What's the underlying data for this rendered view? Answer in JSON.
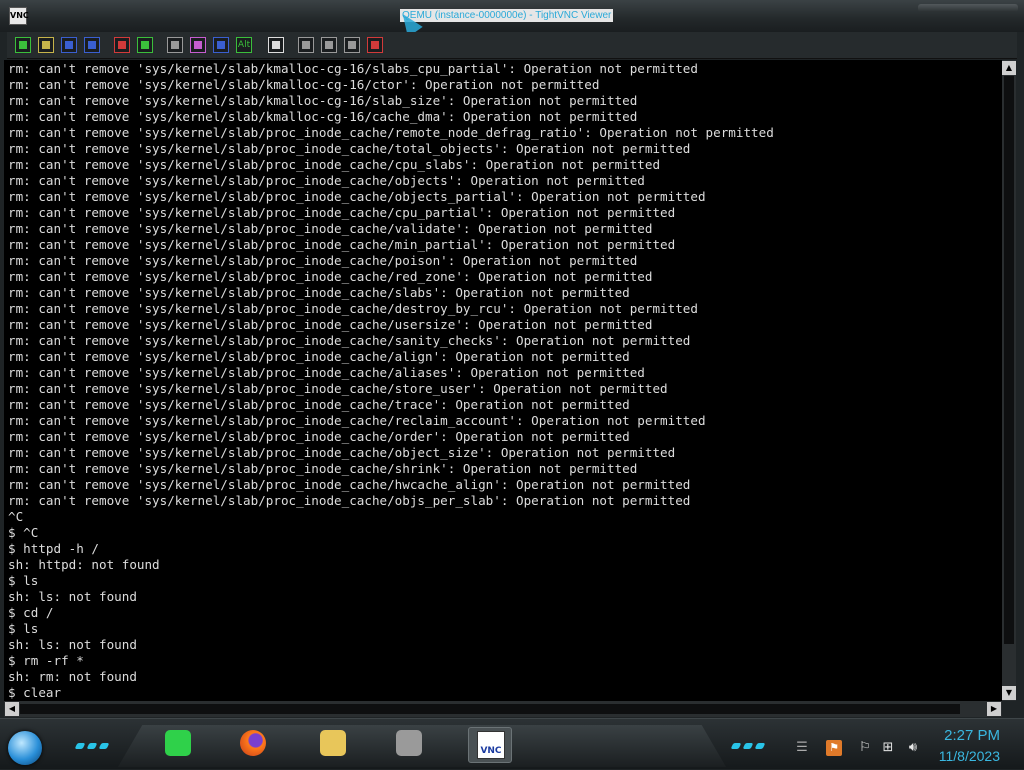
{
  "window": {
    "title": "QEMU (instance-0000000e) - TightVNC Viewer",
    "app_icon": "VNC"
  },
  "toolbar": {
    "buttons": [
      {
        "name": "new-connection-icon",
        "color": "#3bbf3b"
      },
      {
        "name": "save-session-icon",
        "color": "#c6b44a"
      },
      {
        "name": "options-icon",
        "color": "#3a5fd0"
      },
      {
        "name": "connection-info-icon",
        "color": "#3a5fd0"
      },
      {
        "name": "pause-icon",
        "color": "#d23a3a"
      },
      {
        "name": "refresh-icon",
        "color": "#3bbf3b"
      },
      {
        "name": "ctrl-alt-del-icon",
        "color": "#999999"
      },
      {
        "name": "ctrl-esc-icon",
        "color": "#c65dd0"
      },
      {
        "name": "ctrl-key-icon",
        "color": "#3a5fd0"
      },
      {
        "name": "alt-key-icon",
        "color": "#3bbf3b"
      },
      {
        "name": "fullscreen-icon",
        "color": "#dddddd"
      },
      {
        "name": "zoom-in-icon",
        "color": "#999999"
      },
      {
        "name": "zoom-out-icon",
        "color": "#999999"
      },
      {
        "name": "zoom-fit-icon",
        "color": "#999999"
      },
      {
        "name": "zoom-auto-icon",
        "color": "#d23a3a"
      }
    ],
    "alt_label": "Alt"
  },
  "terminal": {
    "lines": [
      "rm: can't remove 'sys/kernel/slab/kmalloc-cg-16/slabs_cpu_partial': Operation not permitted",
      "rm: can't remove 'sys/kernel/slab/kmalloc-cg-16/ctor': Operation not permitted",
      "rm: can't remove 'sys/kernel/slab/kmalloc-cg-16/slab_size': Operation not permitted",
      "rm: can't remove 'sys/kernel/slab/kmalloc-cg-16/cache_dma': Operation not permitted",
      "rm: can't remove 'sys/kernel/slab/proc_inode_cache/remote_node_defrag_ratio': Operation not permitted",
      "rm: can't remove 'sys/kernel/slab/proc_inode_cache/total_objects': Operation not permitted",
      "rm: can't remove 'sys/kernel/slab/proc_inode_cache/cpu_slabs': Operation not permitted",
      "rm: can't remove 'sys/kernel/slab/proc_inode_cache/objects': Operation not permitted",
      "rm: can't remove 'sys/kernel/slab/proc_inode_cache/objects_partial': Operation not permitted",
      "rm: can't remove 'sys/kernel/slab/proc_inode_cache/cpu_partial': Operation not permitted",
      "rm: can't remove 'sys/kernel/slab/proc_inode_cache/validate': Operation not permitted",
      "rm: can't remove 'sys/kernel/slab/proc_inode_cache/min_partial': Operation not permitted",
      "rm: can't remove 'sys/kernel/slab/proc_inode_cache/poison': Operation not permitted",
      "rm: can't remove 'sys/kernel/slab/proc_inode_cache/red_zone': Operation not permitted",
      "rm: can't remove 'sys/kernel/slab/proc_inode_cache/slabs': Operation not permitted",
      "rm: can't remove 'sys/kernel/slab/proc_inode_cache/destroy_by_rcu': Operation not permitted",
      "rm: can't remove 'sys/kernel/slab/proc_inode_cache/usersize': Operation not permitted",
      "rm: can't remove 'sys/kernel/slab/proc_inode_cache/sanity_checks': Operation not permitted",
      "rm: can't remove 'sys/kernel/slab/proc_inode_cache/align': Operation not permitted",
      "rm: can't remove 'sys/kernel/slab/proc_inode_cache/aliases': Operation not permitted",
      "rm: can't remove 'sys/kernel/slab/proc_inode_cache/store_user': Operation not permitted",
      "rm: can't remove 'sys/kernel/slab/proc_inode_cache/trace': Operation not permitted",
      "rm: can't remove 'sys/kernel/slab/proc_inode_cache/reclaim_account': Operation not permitted",
      "rm: can't remove 'sys/kernel/slab/proc_inode_cache/order': Operation not permitted",
      "rm: can't remove 'sys/kernel/slab/proc_inode_cache/object_size': Operation not permitted",
      "rm: can't remove 'sys/kernel/slab/proc_inode_cache/shrink': Operation not permitted",
      "rm: can't remove 'sys/kernel/slab/proc_inode_cache/hwcache_align': Operation not permitted",
      "rm: can't remove 'sys/kernel/slab/proc_inode_cache/objs_per_slab': Operation not permitted",
      "^C",
      "$ ^C",
      "$ httpd -h /",
      "sh: httpd: not found",
      "$ ls",
      "sh: ls: not found",
      "$ cd /",
      "$ ls",
      "sh: ls: not found",
      "$ rm -rf *",
      "sh: rm: not found",
      "$ clear"
    ]
  },
  "taskbar": {
    "apps": [
      {
        "name": "notes-app-icon",
        "color": "#2fd14a"
      },
      {
        "name": "firefox-icon",
        "color": "#ff7a1a"
      },
      {
        "name": "file-explorer-icon",
        "color": "#e8c65a"
      },
      {
        "name": "firewall-icon",
        "color": "#9a9a9a"
      },
      {
        "name": "tightvnc-icon",
        "color": "#ffffff",
        "label": "VNC",
        "active": true
      }
    ],
    "clock": {
      "time": "2:27 PM",
      "date": "11/8/2023"
    }
  }
}
